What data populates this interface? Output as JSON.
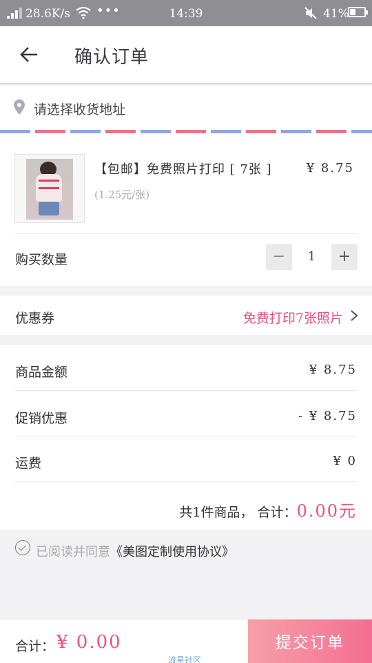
{
  "status_bar": {
    "speed": "28.6K/s",
    "dots": "•••",
    "time": "14:39",
    "battery_pct": "41%",
    "battery_level": 0.41
  },
  "header": {
    "back_icon": "arrow-left-icon",
    "title": "确认订单"
  },
  "address": {
    "icon": "location-pin-icon",
    "placeholder": "请选择收货地址"
  },
  "product": {
    "title": "【包邮】免费照片打印 [ 7张 ]",
    "price": "¥ 8.75",
    "unit_price": "(1.25元/张)",
    "quantity_label": "购买数量",
    "quantity": "1",
    "minus": "−",
    "plus": "+"
  },
  "coupon": {
    "label": "优惠券",
    "value": "免费打印7张照片"
  },
  "summary": {
    "rows": [
      {
        "label": "商品金额",
        "value": "¥ 8.75"
      },
      {
        "label": "促销优惠",
        "value": "- ¥ 8.75"
      },
      {
        "label": "运费",
        "value": "¥ 0"
      }
    ],
    "total_prefix": "共1件商品， 合计：",
    "total_amount": "0.00元"
  },
  "agreement": {
    "prefix": "已阅读并同意",
    "link": "《美图定制使用协议》"
  },
  "footer": {
    "total_label": "合计：",
    "total_amount": "¥ 0.00",
    "watermark": "流星社区",
    "submit": "提交订单"
  },
  "colors": {
    "accent": "#f04f7e",
    "status_bar": "#8e8e93",
    "submit_gradient_start": "#f7a0a8",
    "submit_gradient_end": "#f46e92"
  }
}
